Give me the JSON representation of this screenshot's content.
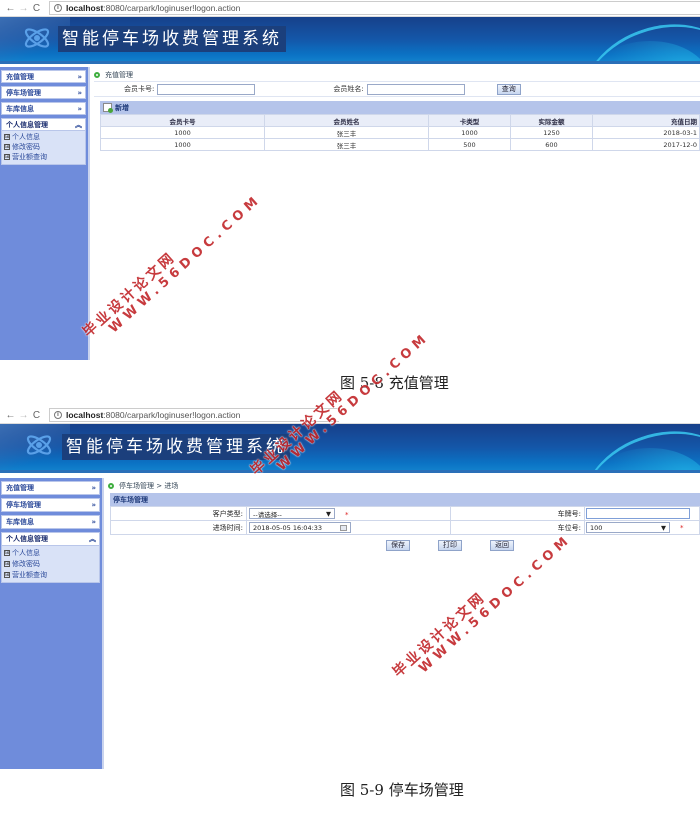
{
  "browser": {
    "back_icon": "←",
    "forward_icon": "→",
    "reload_icon": "C",
    "info_icon": "i",
    "url_host": "localhost",
    "url_rest": ":8080/carpark/loginuser!logon.action"
  },
  "app": {
    "title": "智能停车场收费管理系统",
    "logo_icon": "atom-logo-icon"
  },
  "sidebar": {
    "items": [
      {
        "label": "充值管理",
        "chevron": "»"
      },
      {
        "label": "停车场管理",
        "chevron": "»"
      },
      {
        "label": "车库信息",
        "chevron": "»"
      },
      {
        "label": "个人信息管理",
        "chevron": "︽"
      }
    ],
    "sub_items": [
      {
        "label": "个人信息",
        "icon": "⊞"
      },
      {
        "label": "修改密码",
        "icon": "⊞"
      },
      {
        "label": "营业额查询",
        "icon": "⊞"
      }
    ]
  },
  "screen1": {
    "breadcrumb": "充值管理",
    "search": {
      "card_label": "会员卡号:",
      "card_value": "",
      "name_label": "会员姓名:",
      "name_value": "",
      "query_button": "查询"
    },
    "panel_title": "新增",
    "table": {
      "columns": [
        "会员卡号",
        "会员姓名",
        "卡类型",
        "实际金额",
        "充值日期"
      ],
      "rows": [
        [
          "1000",
          "张三丰",
          "1000",
          "1250",
          "2018-03-1"
        ],
        [
          "1000",
          "张三丰",
          "500",
          "600",
          "2017-12-0"
        ]
      ]
    },
    "caption": "图 5-8 充值管理"
  },
  "screen2": {
    "breadcrumb": "停车场管理 > 进场",
    "panel_title": "停车场管理",
    "form": {
      "customer_type_label": "客户类型:",
      "customer_type_value": "--请选择--",
      "plate_label": "车牌号:",
      "plate_value": "",
      "entry_time_label": "进场时间:",
      "entry_time_value": "2018-05-05 16:04:33",
      "space_label": "车位号:",
      "space_value": "100",
      "required_mark": "*"
    },
    "buttons": {
      "save": "保存",
      "print": "打印",
      "back": "返回"
    },
    "caption": "图 5-9 停车场管理"
  },
  "watermark": {
    "line1": "毕业设计论文网",
    "line2": "WWW.56DOC.COM",
    "color": "#c2262a"
  }
}
